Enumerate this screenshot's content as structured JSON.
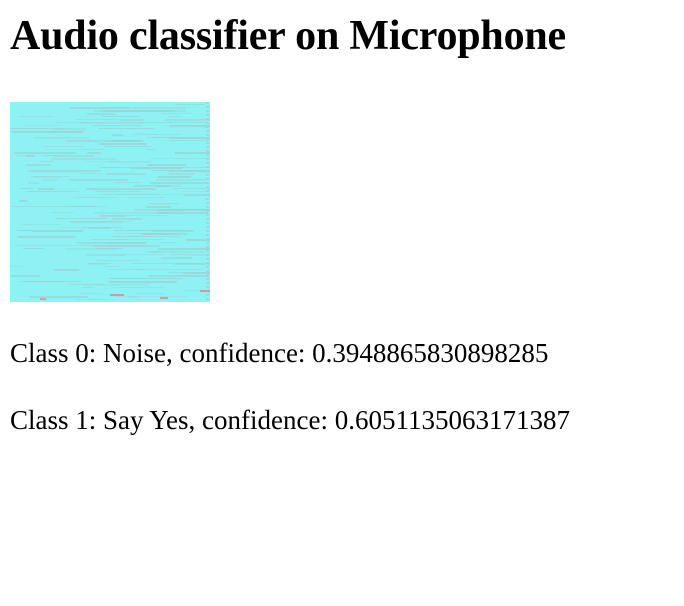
{
  "page": {
    "title": "Audio classifier on Microphone"
  },
  "spectrogram": {
    "base_color": "#8ef1f3",
    "streak_color": "#9ad4d6",
    "hot_color": "#d9888f"
  },
  "results": [
    {
      "text": "Class 0: Noise, confidence: 0.3948865830898285"
    },
    {
      "text": "Class 1: Say Yes, confidence: 0.6051135063171387"
    }
  ]
}
